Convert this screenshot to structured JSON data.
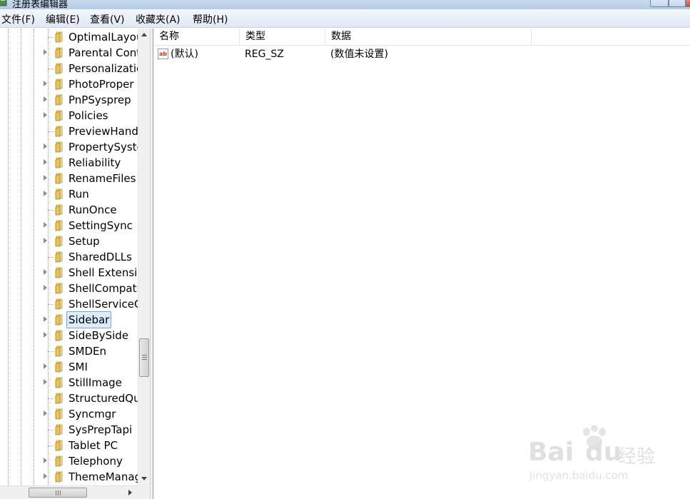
{
  "window": {
    "title": "注册表编辑器"
  },
  "menu": [
    {
      "label": "文件(F)"
    },
    {
      "label": "编辑(E)"
    },
    {
      "label": "查看(V)"
    },
    {
      "label": "收藏夹(A)"
    },
    {
      "label": "帮助(H)"
    }
  ],
  "tree": {
    "selected": "Sidebar",
    "items": [
      {
        "label": "OptimalLayou",
        "expandable": false
      },
      {
        "label": "Parental Cont",
        "expandable": true
      },
      {
        "label": "Personalizatic",
        "expandable": false
      },
      {
        "label": "PhotoProper",
        "expandable": true
      },
      {
        "label": "PnPSysprep",
        "expandable": true
      },
      {
        "label": "Policies",
        "expandable": true
      },
      {
        "label": "PreviewHand",
        "expandable": false
      },
      {
        "label": "PropertySyste",
        "expandable": true
      },
      {
        "label": "Reliability",
        "expandable": true
      },
      {
        "label": "RenameFiles",
        "expandable": true
      },
      {
        "label": "Run",
        "expandable": true
      },
      {
        "label": "RunOnce",
        "expandable": false
      },
      {
        "label": "SettingSync",
        "expandable": true
      },
      {
        "label": "Setup",
        "expandable": true
      },
      {
        "label": "SharedDLLs",
        "expandable": false
      },
      {
        "label": "Shell Extensic",
        "expandable": true
      },
      {
        "label": "ShellCompati",
        "expandable": true
      },
      {
        "label": "ShellServiceC",
        "expandable": false
      },
      {
        "label": "Sidebar",
        "expandable": true
      },
      {
        "label": "SideBySide",
        "expandable": true
      },
      {
        "label": "SMDEn",
        "expandable": false
      },
      {
        "label": "SMI",
        "expandable": true
      },
      {
        "label": "StillImage",
        "expandable": true
      },
      {
        "label": "StructuredQu",
        "expandable": false
      },
      {
        "label": "Syncmgr",
        "expandable": true
      },
      {
        "label": "SysPrepTapi",
        "expandable": false
      },
      {
        "label": "Tablet PC",
        "expandable": false
      },
      {
        "label": "Telephony",
        "expandable": true
      },
      {
        "label": "ThemeManag",
        "expandable": true
      }
    ]
  },
  "list": {
    "columns": [
      {
        "label": "名称"
      },
      {
        "label": "类型"
      },
      {
        "label": "数据"
      },
      {
        "label": ""
      }
    ],
    "rows": [
      {
        "icon": "string-value-icon",
        "icon_text": "ab",
        "name": "(默认)",
        "type": "REG_SZ",
        "data": "(数值未设置)"
      }
    ]
  },
  "watermark": {
    "brand": "Bai",
    "brand2": "du",
    "suffix": "经验",
    "url": "jingyan.baidu.com"
  },
  "colors": {
    "selection_bg": "#dcebfc",
    "selection_border": "#7da2ce",
    "folder": "#e8c25a"
  }
}
